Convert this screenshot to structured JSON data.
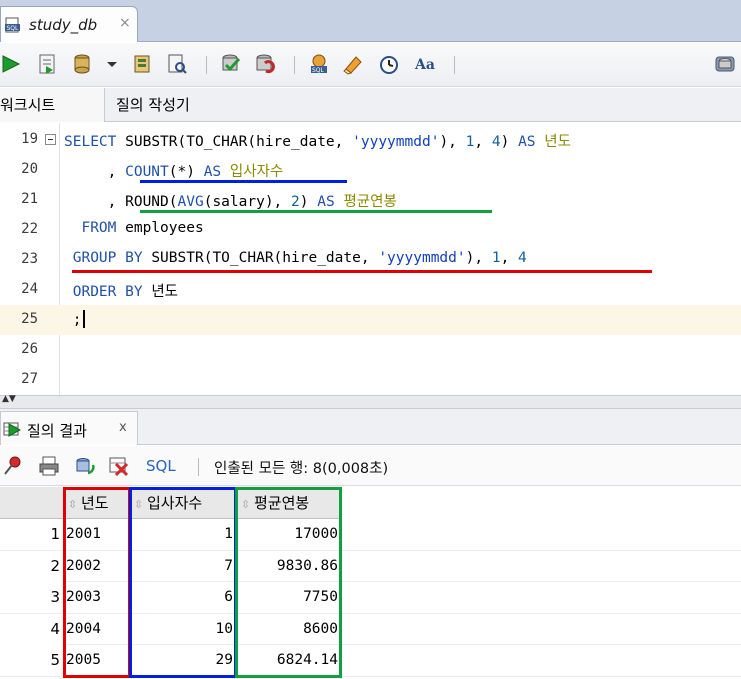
{
  "window": {
    "doc_tab_title": "study_db",
    "doc_tab_close": "×"
  },
  "subtabs": {
    "worksheet": "워크시트",
    "query_builder": "질의 작성기"
  },
  "editor": {
    "lines": [
      {
        "num": "19"
      },
      {
        "num": "20"
      },
      {
        "num": "21"
      },
      {
        "num": "22"
      },
      {
        "num": "23"
      },
      {
        "num": "24"
      },
      {
        "num": "25"
      },
      {
        "num": "26"
      },
      {
        "num": "27"
      }
    ],
    "tokens": {
      "select": "SELECT",
      "substr": "SUBSTR",
      "to_char": "TO_CHAR",
      "hire_date": "hire_date",
      "fmt": "'yyyymmdd'",
      "one": "1",
      "four": "4",
      "as": "AS",
      "alias_year": "년도",
      "count": "COUNT",
      "star": "(*)",
      "alias_hires": "입사자수",
      "round": "ROUND",
      "avg": "AVG",
      "salary": "salary",
      "two": "2",
      "alias_avg": "평균연봉",
      "from": "FROM",
      "employees": "employees",
      "group_by": "GROUP BY",
      "order_by": "ORDER BY",
      "semicolon": ";"
    }
  },
  "result": {
    "tab_title": "질의 결과",
    "tab_close": "x",
    "sql_label": "SQL",
    "status": "인출된 모든 행: 8(0,008초)",
    "columns": [
      "년도",
      "입사자수",
      "평균연봉"
    ],
    "rows": [
      {
        "n": "1",
        "year": "2001",
        "count": "1",
        "avg": "17000"
      },
      {
        "n": "2",
        "year": "2002",
        "count": "7",
        "avg": "9830.86"
      },
      {
        "n": "3",
        "year": "2003",
        "count": "6",
        "avg": "7750"
      },
      {
        "n": "4",
        "year": "2004",
        "count": "10",
        "avg": "8600"
      },
      {
        "n": "5",
        "year": "2005",
        "count": "29",
        "avg": "6824.14"
      }
    ]
  },
  "colors": {
    "highlight_red": "#e00000",
    "highlight_blue": "#0020e0",
    "highlight_green": "#10a040"
  }
}
